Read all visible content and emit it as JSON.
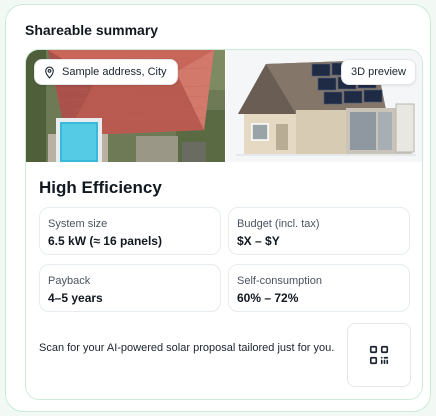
{
  "summary": {
    "heading": "Shareable summary",
    "address_label": "Sample address, City",
    "preview_label": "3D preview",
    "title": "High Efficiency",
    "stats": [
      {
        "label": "System size",
        "value": "6.5 kW (≈ 16 panels)"
      },
      {
        "label": "Budget (incl. tax)",
        "value": "$X – $Y"
      },
      {
        "label": "Payback",
        "value": "4–5 years"
      },
      {
        "label": "Self-consumption",
        "value": "60% – 72%"
      }
    ],
    "scan_text": "Scan for your AI-powered solar proposal tailored just for you.",
    "icons": {
      "address": "map-pin-icon",
      "qr": "qr-code-icon"
    }
  }
}
